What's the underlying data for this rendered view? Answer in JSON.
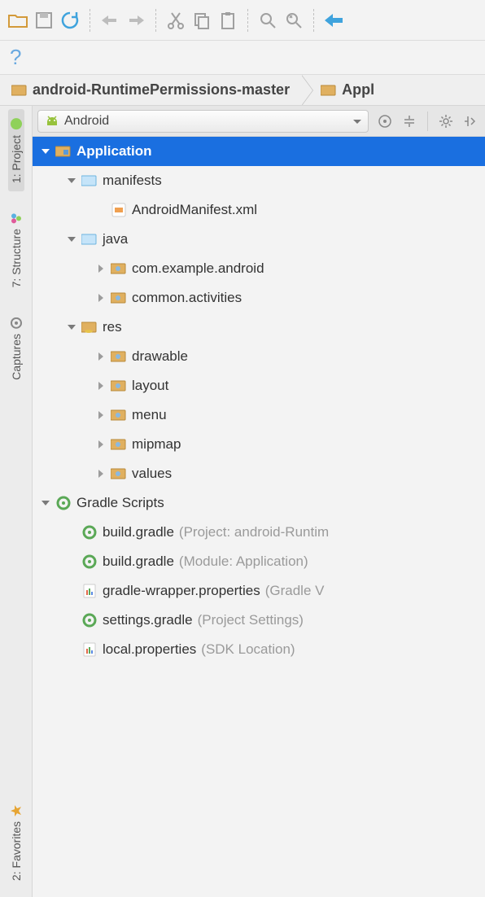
{
  "toolbar": {},
  "breadcrumb": {
    "crumb1": "android-RuntimePermissions-master",
    "crumb2": "Appl"
  },
  "sidebar": {
    "project": "1: Project",
    "structure": "7: Structure",
    "captures": "Captures",
    "favorites": "2: Favorites"
  },
  "panel": {
    "view": "Android"
  },
  "tree": {
    "application": "Application",
    "manifests": "manifests",
    "androidmanifest": "AndroidManifest.xml",
    "java": "java",
    "pkg1": "com.example.android",
    "pkg2": "common.activities",
    "res": "res",
    "drawable": "drawable",
    "layout": "layout",
    "menu": "menu",
    "mipmap": "mipmap",
    "values": "values",
    "gradle": "Gradle Scripts",
    "bg1": "build.gradle",
    "bg1h": "(Project: android-Runtim",
    "bg2": "build.gradle",
    "bg2h": "(Module: Application)",
    "gwp": "gradle-wrapper.properties",
    "gwph": "(Gradle V",
    "sg": "settings.gradle",
    "sgh": "(Project Settings)",
    "lp": "local.properties",
    "lph": "(SDK Location)"
  }
}
